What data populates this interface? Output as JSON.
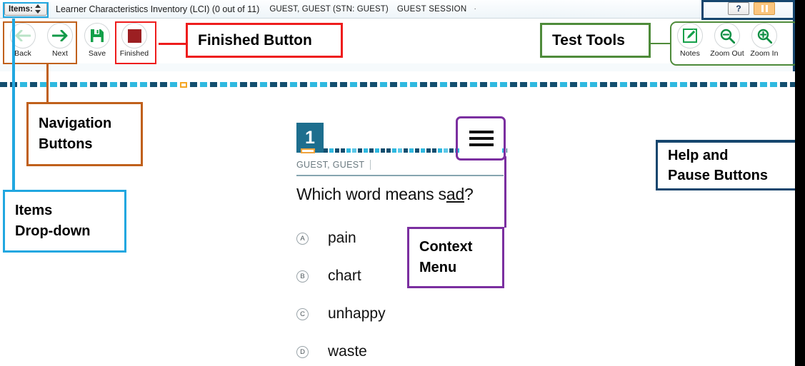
{
  "window": {
    "items_dropdown_label": "Items:",
    "test_title": "Learner Characteristics Inventory (LCI) (0 out of 11)",
    "student": "GUEST, GUEST (STN: GUEST)",
    "session": "GUEST SESSION",
    "trailing_mark": "·"
  },
  "toolbar": {
    "left_buttons": [
      {
        "label": "Back",
        "icon": "arrow-left-icon",
        "state": "disabled"
      },
      {
        "label": "Next",
        "icon": "arrow-right-icon",
        "state": "enabled"
      },
      {
        "label": "Save",
        "icon": "floppy-disk-icon",
        "state": "enabled"
      },
      {
        "label": "Finished",
        "icon": "stop-square-icon",
        "state": "enabled"
      }
    ],
    "right_buttons": [
      {
        "label": "Notes",
        "icon": "note-pencil-icon"
      },
      {
        "label": "Zoom Out",
        "icon": "magnifier-minus-icon"
      },
      {
        "label": "Zoom In",
        "icon": "magnifier-plus-icon"
      }
    ],
    "help_button": {
      "label": "?",
      "icon": "question-mark-icon"
    },
    "pause_button": {
      "label": "",
      "icon": "pause-icon"
    }
  },
  "question": {
    "number": "1",
    "user": "GUEST, GUEST",
    "stem_before": "Which word means s",
    "stem_underlined": "ad",
    "stem_after": "?",
    "stem_full": "Which word means sad?",
    "menu_icon": "hamburger-menu-icon",
    "options": [
      {
        "letter": "A",
        "text": "pain"
      },
      {
        "letter": "B",
        "text": "chart"
      },
      {
        "letter": "C",
        "text": "unhappy"
      },
      {
        "letter": "D",
        "text": "waste"
      }
    ]
  },
  "annotations": [
    {
      "id": "finished",
      "lines": [
        "Finished Button"
      ],
      "color": "#ee1c1c"
    },
    {
      "id": "testtools",
      "lines": [
        "Test Tools"
      ],
      "color": "#4e8b3a"
    },
    {
      "id": "nav",
      "lines": [
        "Navigation",
        "Buttons"
      ],
      "color": "#c0601b"
    },
    {
      "id": "items",
      "lines": [
        "Items",
        "Drop-down"
      ],
      "color": "#21a7e0"
    },
    {
      "id": "context",
      "lines": [
        "Context",
        "Menu"
      ],
      "color": "#7b2fa0"
    },
    {
      "id": "help",
      "lines": [
        "Help and",
        "Pause Buttons"
      ],
      "color": "#16466e"
    }
  ],
  "colors": {
    "progress_navy": "#134e6f",
    "progress_cyan": "#2fb9e0",
    "progress_current": "#f5a623",
    "question_badge": "#1d6e8e",
    "accent_green": "#139a49",
    "finished_red": "#9c1f22"
  }
}
